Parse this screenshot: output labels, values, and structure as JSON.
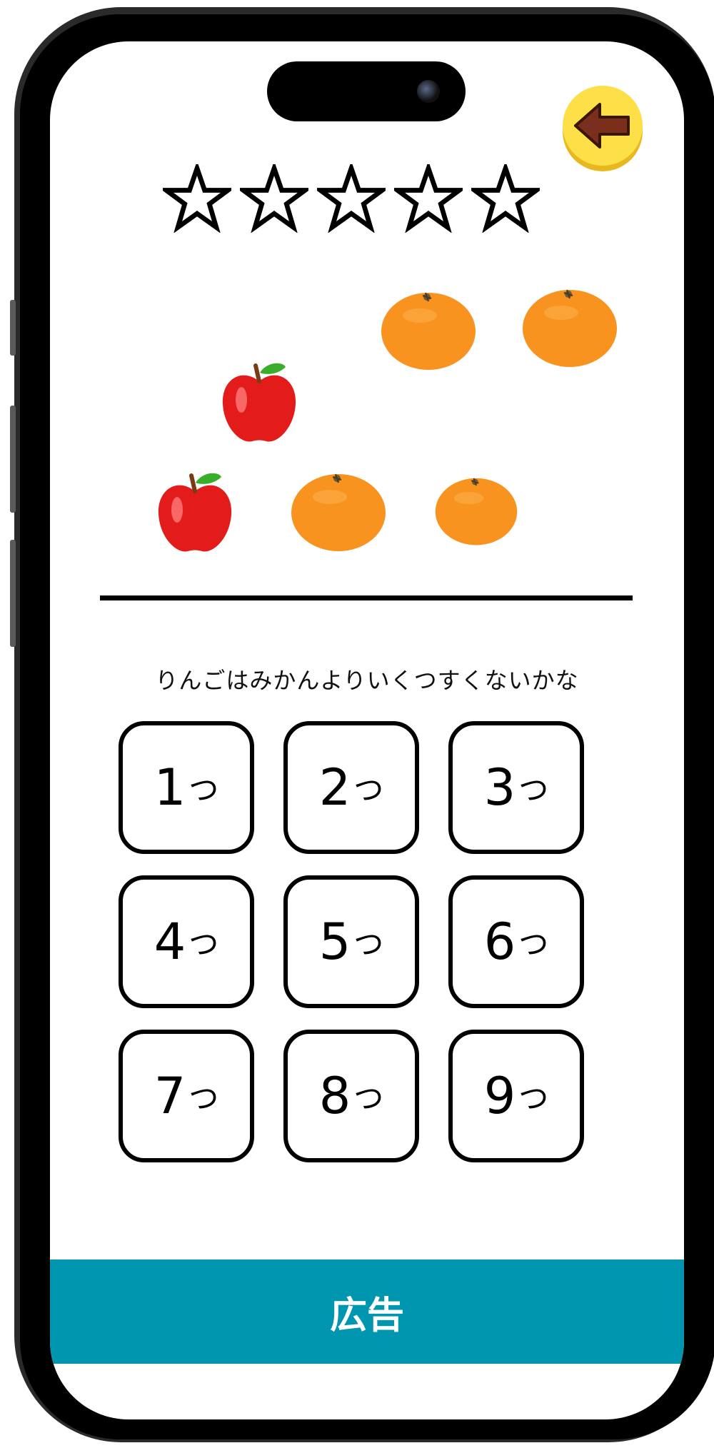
{
  "header": {
    "back_icon": "arrow-left-icon",
    "back_button_color": "#fde047"
  },
  "progress": {
    "stars_total": 5,
    "stars_filled": 0
  },
  "scene": {
    "apples": 2,
    "oranges": 4
  },
  "question": {
    "text": "りんごはみかんよりいくつすくないかな"
  },
  "answers": [
    {
      "number": "1",
      "unit": "つ"
    },
    {
      "number": "2",
      "unit": "つ"
    },
    {
      "number": "3",
      "unit": "つ"
    },
    {
      "number": "4",
      "unit": "つ"
    },
    {
      "number": "5",
      "unit": "つ"
    },
    {
      "number": "6",
      "unit": "つ"
    },
    {
      "number": "7",
      "unit": "つ"
    },
    {
      "number": "8",
      "unit": "つ"
    },
    {
      "number": "9",
      "unit": "つ"
    }
  ],
  "ad": {
    "label": "広告",
    "color": "#0096b0"
  }
}
